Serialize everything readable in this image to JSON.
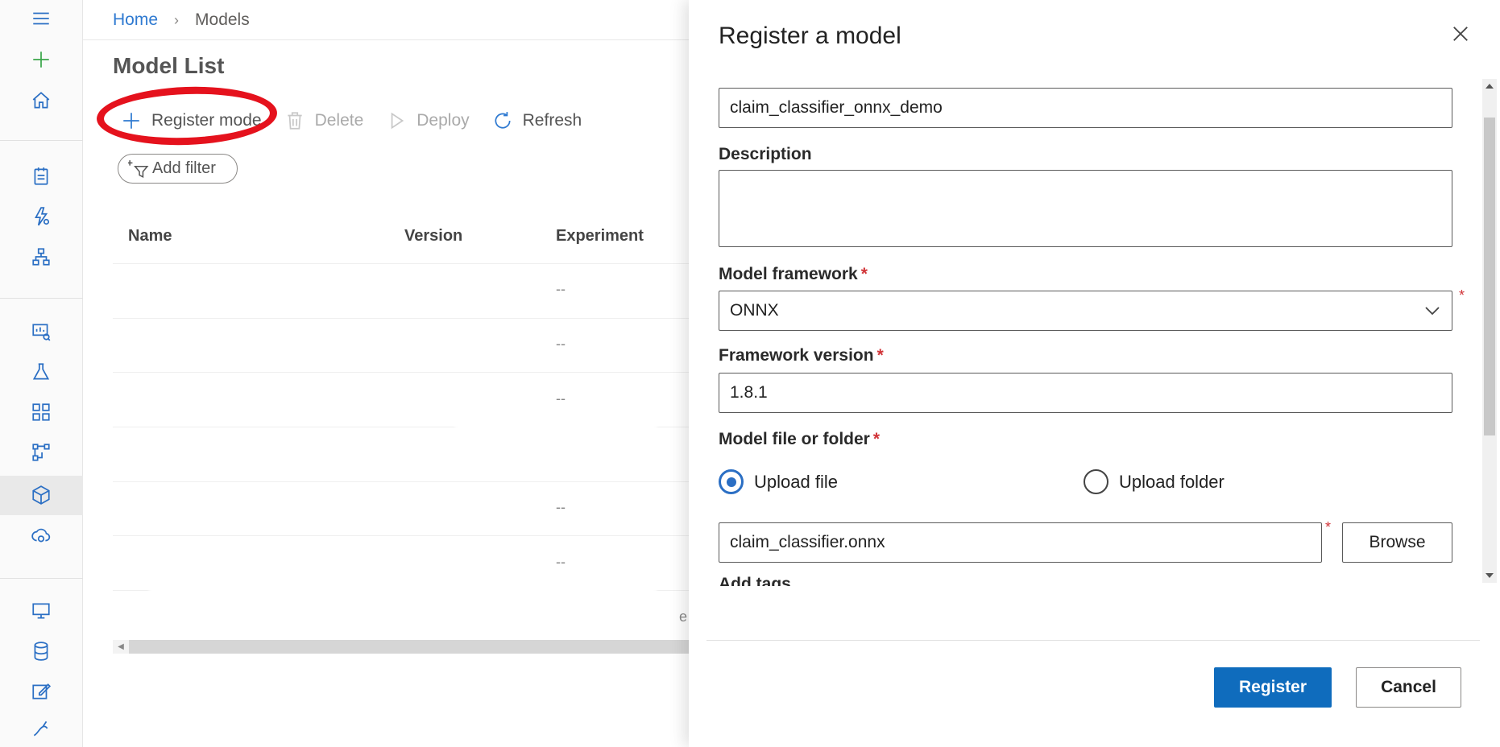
{
  "breadcrumb": {
    "home": "Home",
    "separator": "›",
    "current": "Models"
  },
  "page": {
    "title": "Model List"
  },
  "toolbar": {
    "register_label": "Register mode",
    "delete_label": "Delete",
    "deploy_label": "Deploy",
    "refresh_label": "Refresh"
  },
  "filter": {
    "label": "Add filter"
  },
  "table": {
    "columns": [
      "Name",
      "Version",
      "Experiment"
    ],
    "rows": [
      {
        "experiment": "--"
      },
      {
        "experiment": "--"
      },
      {
        "experiment": "--"
      },
      {
        "experiment": ""
      },
      {
        "experiment": "--"
      },
      {
        "experiment": "--"
      },
      {
        "experiment": "e"
      }
    ]
  },
  "nav_rail": {
    "icons": [
      "menu-icon",
      "plus-icon",
      "home-icon",
      "notebook-icon",
      "automl-icon",
      "designer-icon",
      "datasets-icon",
      "experiments-icon",
      "pipelines-icon",
      "pipelines-icon-2",
      "models-icon",
      "endpoints-icon",
      "compute-icon",
      "datastores-icon",
      "data-labeling-icon",
      "linked-services-icon"
    ],
    "selected": "models-icon"
  },
  "panel": {
    "title": "Register a model",
    "name_value": "claim_classifier_onnx_demo",
    "description_label": "Description",
    "description_value": "",
    "framework_label": "Model framework",
    "framework_value": "ONNX",
    "framework_version_label": "Framework version",
    "framework_version_value": "1.8.1",
    "file_label": "Model file or folder",
    "upload_file_label": "Upload file",
    "upload_folder_label": "Upload folder",
    "selected_upload": "Upload file",
    "file_value": "claim_classifier.onnx",
    "browse_label": "Browse",
    "tags_label": "Add tags",
    "required_marker": "*",
    "register_label": "Register",
    "cancel_label": "Cancel"
  },
  "colors": {
    "accent": "#0f6cbd",
    "link": "#2f7ad1",
    "required": "#d13438",
    "annotation": "#e5121d"
  }
}
